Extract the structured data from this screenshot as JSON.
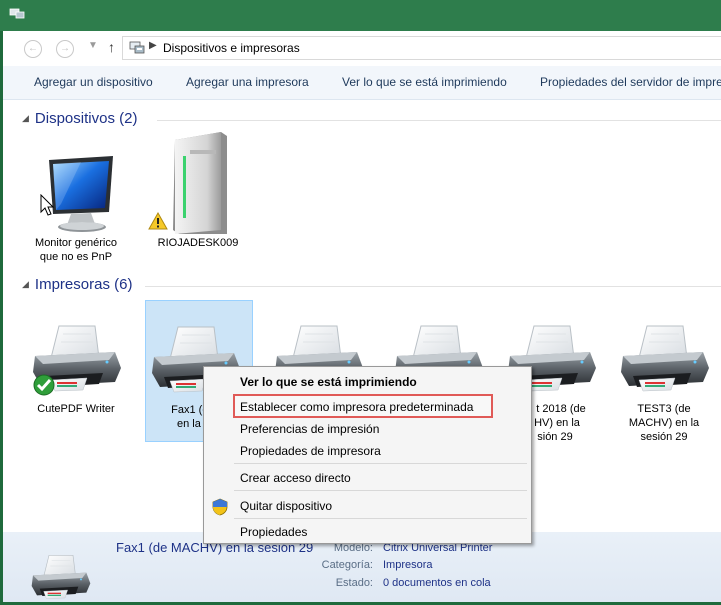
{
  "address": {
    "path": "Dispositivos e impresoras"
  },
  "toolbar": {
    "add_device": "Agregar un dispositivo",
    "add_printer": "Agregar una impresora",
    "see_printing": "Ver lo que se está imprimiendo",
    "server_props": "Propiedades del servidor de impre"
  },
  "groups": {
    "devices": "Dispositivos (2)",
    "printers": "Impresoras (6)"
  },
  "devices": [
    {
      "label1": "Monitor genérico",
      "label2": "que no es PnP",
      "icon": "monitor-icon"
    },
    {
      "label1": "RIOJADESK009",
      "label2": "",
      "icon": "computer-tower-icon"
    }
  ],
  "printers": [
    {
      "label1": "CutePDF Writer",
      "label2": "",
      "label3": ""
    },
    {
      "label1": "Fax1 (de M",
      "label2": "en la ses",
      "label3": ""
    },
    {
      "label1": "t 2018 (de",
      "label2": "HV) en la",
      "label3": "sión 29"
    },
    {
      "label1": "TEST3 (de",
      "label2": "MACHV) en la",
      "label3": "sesión 29"
    }
  ],
  "context_menu": {
    "items": [
      "Ver lo que se está imprimiendo",
      "Establecer como impresora predeterminada",
      "Preferencias de impresión",
      "Propiedades de impresora",
      "Crear acceso directo",
      "Quitar dispositivo",
      "Propiedades"
    ]
  },
  "details": {
    "name": "Fax1 (de MACHV) en la sesión 29",
    "model_label": "Modelo:",
    "model_value": "Citrix Universal Printer",
    "category_label": "Categoría:",
    "category_value": "Impresora",
    "status_label": "Estado:",
    "status_value": "0 documentos en cola"
  },
  "colors": {
    "titlebar": "#2e7d4c",
    "link_blue": "#1e3287",
    "highlight_box": "#e05a57",
    "selection": "#cce4f7"
  }
}
